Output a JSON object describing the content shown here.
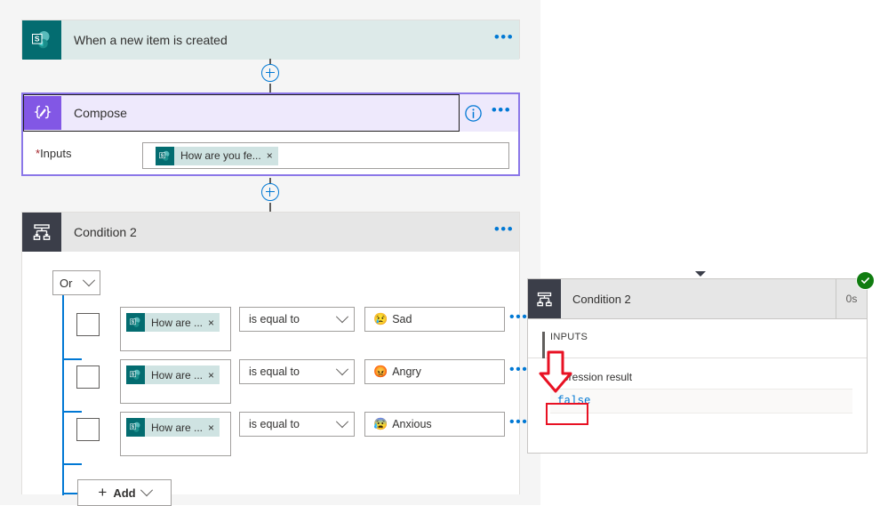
{
  "canvas": {
    "trigger": {
      "title": "When a new item is created",
      "icon": "sharepoint-icon",
      "more_label": "•••"
    },
    "compose": {
      "title": "Compose",
      "icon": "compose-braces-icon",
      "info_label": "i",
      "more_label": "•••",
      "inputs_label": "Inputs",
      "required_marker": "*",
      "token": {
        "label": "How are you fe...",
        "remove_label": "×",
        "icon": "sharepoint-icon"
      }
    },
    "condition": {
      "title": "Condition 2",
      "icon": "condition-branch-icon",
      "more_label": "•••",
      "logic_operator": "Or",
      "rows": [
        {
          "token_label": "How are ...",
          "token_remove": "×",
          "operator": "is equal to",
          "value_emoji": "😢",
          "value_text": "Sad",
          "more_label": "•••"
        },
        {
          "token_label": "How are ...",
          "token_remove": "×",
          "operator": "is equal to",
          "value_emoji": "😡",
          "value_text": "Angry",
          "more_label": "•••"
        },
        {
          "token_label": "How are ...",
          "token_remove": "×",
          "operator": "is equal to",
          "value_emoji": "😰",
          "value_text": "Anxious",
          "more_label": "•••"
        }
      ],
      "add_button": {
        "plus": "+",
        "label": "Add"
      }
    }
  },
  "run_panel": {
    "title": "Condition 2",
    "duration": "0s",
    "status_icon": "success-check-icon",
    "section_label": "INPUTS",
    "field_label": "Expression result",
    "value": "false"
  },
  "colors": {
    "sharepoint_teal": "#036c70",
    "compose_purple": "#8257e5",
    "compose_border": "#8b77e8",
    "condition_dark": "#3b3e49",
    "accent_blue": "#0078d4",
    "success_green": "#107c10",
    "annotation_red": "#e81123",
    "canvas_bg": "#f5f5f5"
  }
}
